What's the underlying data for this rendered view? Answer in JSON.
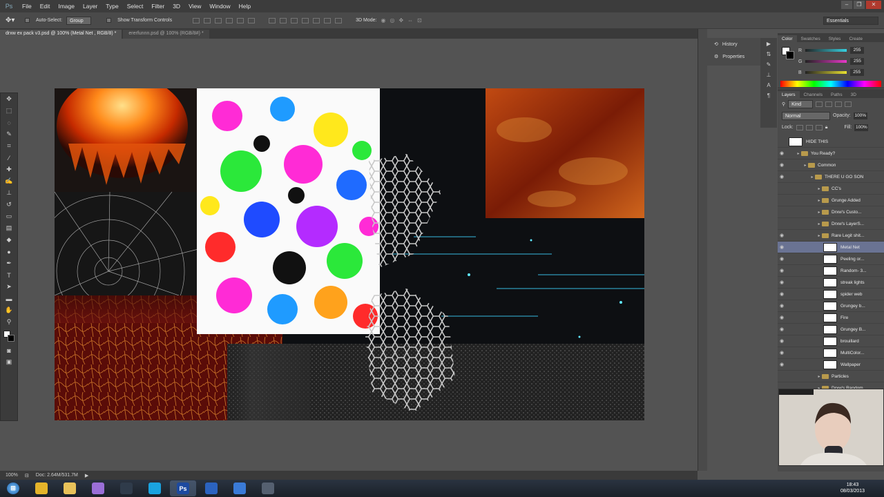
{
  "menu": [
    "File",
    "Edit",
    "Image",
    "Layer",
    "Type",
    "Select",
    "Filter",
    "3D",
    "View",
    "Window",
    "Help"
  ],
  "options_bar": {
    "auto_select_label": "Auto-Select:",
    "auto_select_value": "Group",
    "transform_label": "Show Transform Controls",
    "mode_label": "3D Mode:",
    "workspace": "Essentials"
  },
  "doc_tabs": [
    {
      "label": "drxw ex pack v3.psd @ 100% (Metal Net , RGB/8) *",
      "active": true
    },
    {
      "label": "ererfunnn.psd @ 100% (RGB/8#) *",
      "active": false
    }
  ],
  "mini_panel": {
    "history": "History",
    "properties": "Properties"
  },
  "color_panel": {
    "tabs": [
      "Color",
      "Swatches",
      "Styles",
      "Create"
    ],
    "channels": [
      {
        "label": "R",
        "value": "255",
        "color": "#37d0e0"
      },
      {
        "label": "G",
        "value": "255",
        "color": "#e838c8"
      },
      {
        "label": "B",
        "value": "255",
        "color": "#e8e030"
      }
    ]
  },
  "layers_panel": {
    "tabs": [
      "Layers",
      "Channels",
      "Paths",
      "3D"
    ],
    "filter": "Kind",
    "blend_mode": "Normal",
    "opacity_label": "Opacity:",
    "opacity": "100%",
    "lock_label": "Lock:",
    "fill_label": "Fill:",
    "fill": "100%",
    "layers": [
      {
        "name": "HIDE THIS",
        "kind": "layer",
        "indent": 0,
        "visible": false
      },
      {
        "name": "You Ready?",
        "kind": "folder",
        "indent": 1,
        "visible": true
      },
      {
        "name": "Common",
        "kind": "folder",
        "indent": 2,
        "visible": true
      },
      {
        "name": "THERE U GO SON",
        "kind": "folder",
        "indent": 3,
        "visible": true
      },
      {
        "name": "CC's",
        "kind": "folder",
        "indent": 4,
        "visible": false
      },
      {
        "name": "Grunge Added",
        "kind": "folder",
        "indent": 4,
        "visible": false
      },
      {
        "name": "Drxw's Custo...",
        "kind": "folder",
        "indent": 4,
        "visible": false
      },
      {
        "name": "Drxw's LayerS...",
        "kind": "folder",
        "indent": 4,
        "visible": false
      },
      {
        "name": "Rare Legit shit...",
        "kind": "folder",
        "indent": 4,
        "visible": true
      },
      {
        "name": "Metal Net",
        "kind": "layer",
        "indent": 5,
        "visible": true,
        "selected": true
      },
      {
        "name": "Peeling or...",
        "kind": "layer",
        "indent": 5,
        "visible": true
      },
      {
        "name": "Random- 3...",
        "kind": "layer",
        "indent": 5,
        "visible": true
      },
      {
        "name": "streak lights",
        "kind": "layer",
        "indent": 5,
        "visible": true
      },
      {
        "name": "spider web",
        "kind": "layer",
        "indent": 5,
        "visible": true
      },
      {
        "name": "Grungey b...",
        "kind": "layer",
        "indent": 5,
        "visible": true
      },
      {
        "name": "Fire",
        "kind": "layer",
        "indent": 5,
        "visible": true
      },
      {
        "name": "Grungey B...",
        "kind": "layer",
        "indent": 5,
        "visible": true
      },
      {
        "name": "brouillard",
        "kind": "layer",
        "indent": 5,
        "visible": true
      },
      {
        "name": "MultiColor...",
        "kind": "layer",
        "indent": 5,
        "visible": true
      },
      {
        "name": "Wallpaper",
        "kind": "layer",
        "indent": 5,
        "visible": true
      },
      {
        "name": "Particles",
        "kind": "folder",
        "indent": 4,
        "visible": false
      },
      {
        "name": "Drxw's Random",
        "kind": "folder",
        "indent": 4,
        "visible": false
      }
    ]
  },
  "status": {
    "zoom": "100%",
    "doc": "Doc: 2.64M/531.7M"
  },
  "taskbar": {
    "apps": [
      {
        "icon": "chrome-icon",
        "color": "#e4b42b"
      },
      {
        "icon": "explorer-icon",
        "color": "#e8c25a"
      },
      {
        "icon": "feather-icon",
        "color": "#9a6fd8"
      },
      {
        "icon": "inkscape-icon",
        "color": "#2f3b4a"
      },
      {
        "icon": "skype-icon",
        "color": "#1aa3e0"
      },
      {
        "icon": "photoshop-icon",
        "color": "#1d4aa0",
        "label": "Ps",
        "active": true
      },
      {
        "icon": "firefox-icon",
        "color": "#2b63c0"
      },
      {
        "icon": "itunes-icon",
        "color": "#3a7bd8"
      },
      {
        "icon": "tool-icon",
        "color": "#556070"
      }
    ],
    "time": "18:43",
    "date": "08/03/2013"
  }
}
